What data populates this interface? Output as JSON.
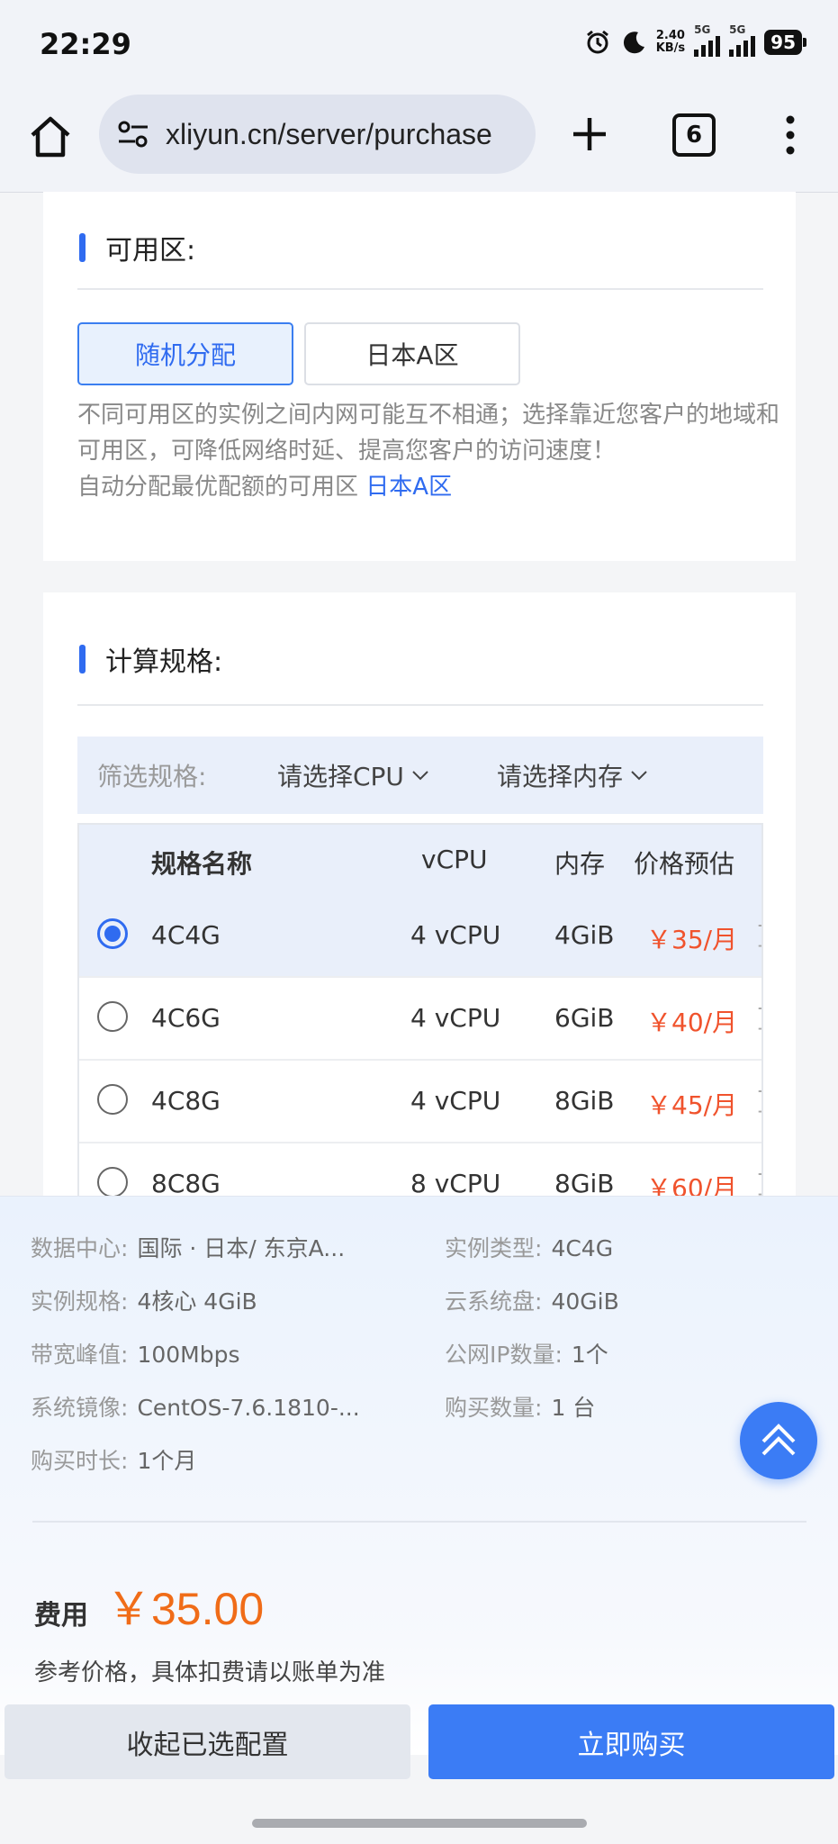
{
  "status_bar": {
    "time": "22:29",
    "net_speed_value": "2.40",
    "net_speed_unit": "KB/s",
    "signal1_label": "5G",
    "signal2_label": "5G",
    "battery": "95",
    "icons": [
      "alarm-icon",
      "moon-icon",
      "signal-icon",
      "battery-icon"
    ]
  },
  "browser": {
    "url": "xliyun.cn/server/purchase",
    "tab_count": "6",
    "icons": [
      "home-icon",
      "tune-icon",
      "plus-icon",
      "more-icon"
    ]
  },
  "zone_section": {
    "title": "可用区:",
    "options": [
      {
        "label": "随机分配",
        "selected": true
      },
      {
        "label": "日本A区",
        "selected": false
      }
    ],
    "description": "不同可用区的实例之间内网可能互不相通；选择靠近您客户的地域和可用区，可降低网络时延、提高您客户的访问速度！",
    "auto_prefix": "自动分配最优配额的可用区",
    "auto_zone": "日本A区"
  },
  "spec_section": {
    "title": "计算规格:",
    "filter_label": "筛选规格:",
    "cpu_select": "请选择CPU",
    "mem_select": "请选择内存",
    "columns": {
      "name": "规格名称",
      "vcpu": "vCPU",
      "mem": "内存",
      "price": "价格预估"
    },
    "rows": [
      {
        "name": "4C4G",
        "vcpu": "4 vCPU",
        "mem": "4GiB",
        "price": "￥35/月",
        "selected": true
      },
      {
        "name": "4C6G",
        "vcpu": "4 vCPU",
        "mem": "6GiB",
        "price": "￥40/月",
        "selected": false
      },
      {
        "name": "4C8G",
        "vcpu": "4 vCPU",
        "mem": "8GiB",
        "price": "￥45/月",
        "selected": false
      },
      {
        "name": "8C8G",
        "vcpu": "8 vCPU",
        "mem": "8GiB",
        "price": "￥60/月",
        "selected": false
      }
    ]
  },
  "summary": {
    "datacenter_label": "数据中心:",
    "datacenter": "国际 · 日本/ 东京A...",
    "instance_type_label": "实例类型:",
    "instance_type": "4C4G",
    "spec_label": "实例规格:",
    "spec": "4核心 4GiB",
    "disk_label": "云系统盘:",
    "disk": "40GiB",
    "bandwidth_label": "带宽峰值:",
    "bandwidth": "100Mbps",
    "ip_label": "公网IP数量:",
    "ip": "1个",
    "image_label": "系统镜像:",
    "image": "CentOS-7.6.1810-...",
    "quantity_label": "购买数量:",
    "quantity": "1 台",
    "duration_label": "购买时长:",
    "duration": "1个月",
    "fee_label": "费用",
    "fee_amount": "￥35.00",
    "fee_note": "参考价格，具体扣费请以账单为准"
  },
  "actions": {
    "collapse_label": "收起已选配置",
    "buy_label": "立即购买"
  },
  "colors": {
    "accent": "#2f6bf0",
    "price": "#f0532d",
    "fee": "#f06c18"
  }
}
